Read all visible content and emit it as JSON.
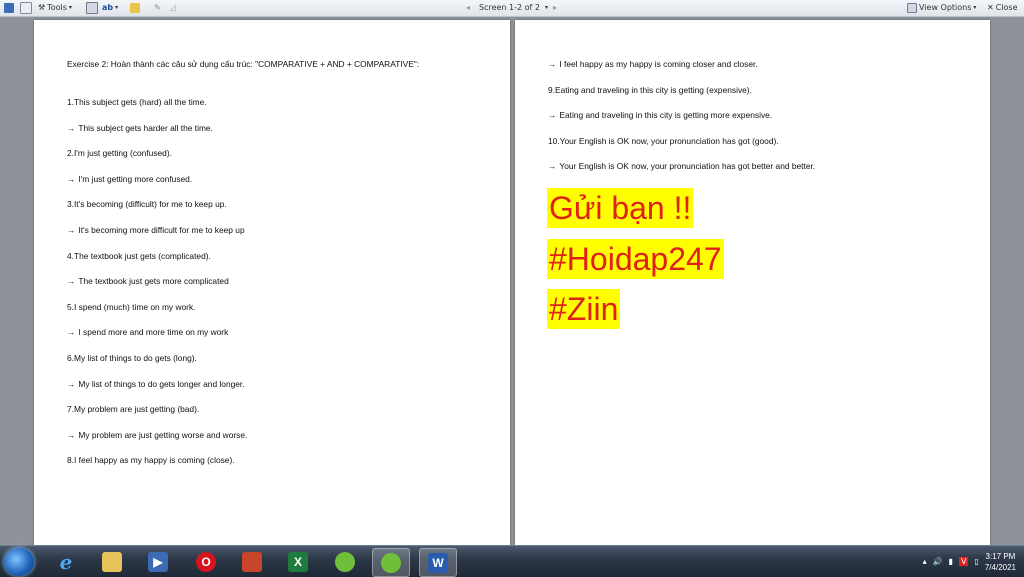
{
  "toolbar": {
    "tools_label": "Tools",
    "screen_label": "Screen 1-2 of 2",
    "view_options_label": "View Options",
    "close_label": "Close"
  },
  "left_page": {
    "lines": [
      "Exercise 2: Hoàn thành các câu sử dụng cấu trúc: \"COMPARATIVE + AND + COMPARATIVE\":",
      "1.This subject gets (hard) all the time.",
      "This subject gets harder all the time.",
      "2.I'm just getting (confused).",
      "I'm just getting more confused.",
      "3.It's becoming (difficult) for me to keep up.",
      "It's becoming more difficult for me to keep up",
      "4.The textbook just gets (complicated).",
      "The textbook just gets more complicated",
      "5.I spend (much) time on my work.",
      "I spend more and more time on my work",
      "6.My list of things to do gets (long).",
      "My list of things to do gets longer and longer.",
      "7.My problem are just getting (bad).",
      "My problem are just getting worse and worse.",
      "8.I feel happy as my happy is coming (close)."
    ]
  },
  "right_page": {
    "lines": [
      "I feel happy as my happy is coming closer and closer.",
      "9.Eating and traveling in this city is getting (expensive).",
      "Eating and traveling in this city is getting more expensive.",
      "10.Your English is OK now, your pronunciation has got (good).",
      "Your English is OK now, your pronunciation has got better and better."
    ],
    "highlights": [
      "Gửi bạn !!",
      "#Hoidap247",
      "#Ziin"
    ]
  },
  "arrow_glyph": "→",
  "taskbar": {
    "time": "3:17 PM",
    "date": "7/4/2021"
  },
  "colors": {
    "highlight_bg": "#ffff00",
    "highlight_text": "#e0201a"
  }
}
